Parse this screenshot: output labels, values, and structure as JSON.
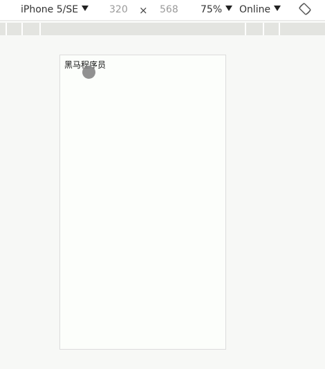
{
  "toolbar": {
    "device": "iPhone 5/SE",
    "width": "320",
    "times": "×",
    "height": "568",
    "zoom": "75%",
    "network": "Online",
    "rotate_icon": "rotate-device-icon"
  },
  "device_page": {
    "text": "黑马程序员"
  },
  "colors": {
    "background": "#f7f8f6",
    "media_bar": "#e3e4e0",
    "cursor": "#858585"
  }
}
